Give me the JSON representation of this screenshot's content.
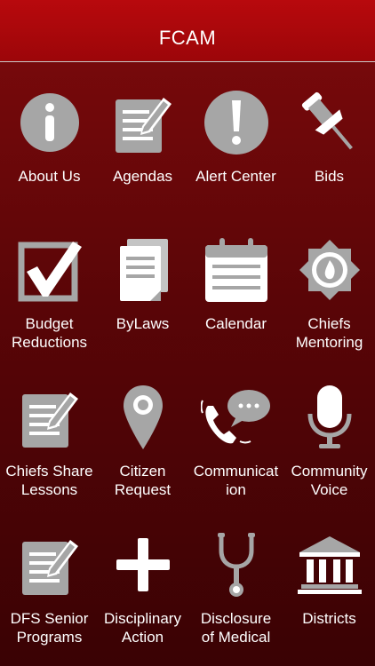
{
  "header": {
    "title": "FCAM"
  },
  "tiles": [
    {
      "label": "About Us",
      "icon": "info-icon"
    },
    {
      "label": "Agendas",
      "icon": "agenda-icon"
    },
    {
      "label": "Alert Center",
      "icon": "alert-icon"
    },
    {
      "label": "Bids",
      "icon": "pushpin-icon"
    },
    {
      "label": "Budget\nReductions",
      "icon": "checkbox-icon"
    },
    {
      "label": "ByLaws",
      "icon": "documents-icon"
    },
    {
      "label": "Calendar",
      "icon": "calendar-icon"
    },
    {
      "label": "Chiefs\nMentoring",
      "icon": "fire-badge-icon"
    },
    {
      "label": "Chiefs Share\nLessons",
      "icon": "share-notes-icon"
    },
    {
      "label": "Citizen\nRequest",
      "icon": "map-pin-icon"
    },
    {
      "label": "Communicat\nion",
      "icon": "phone-chat-icon"
    },
    {
      "label": "Community\nVoice",
      "icon": "microphone-icon"
    },
    {
      "label": "DFS Senior\nPrograms",
      "icon": "programs-icon"
    },
    {
      "label": "Disciplinary\nAction",
      "icon": "plus-icon"
    },
    {
      "label": "Disclosure\nof Medical",
      "icon": "stethoscope-icon"
    },
    {
      "label": "Districts",
      "icon": "building-icon"
    }
  ],
  "colors": {
    "header": "#b8090d",
    "icon": "#a6a6a6",
    "background": "#5a0507",
    "text": "#ffffff"
  }
}
